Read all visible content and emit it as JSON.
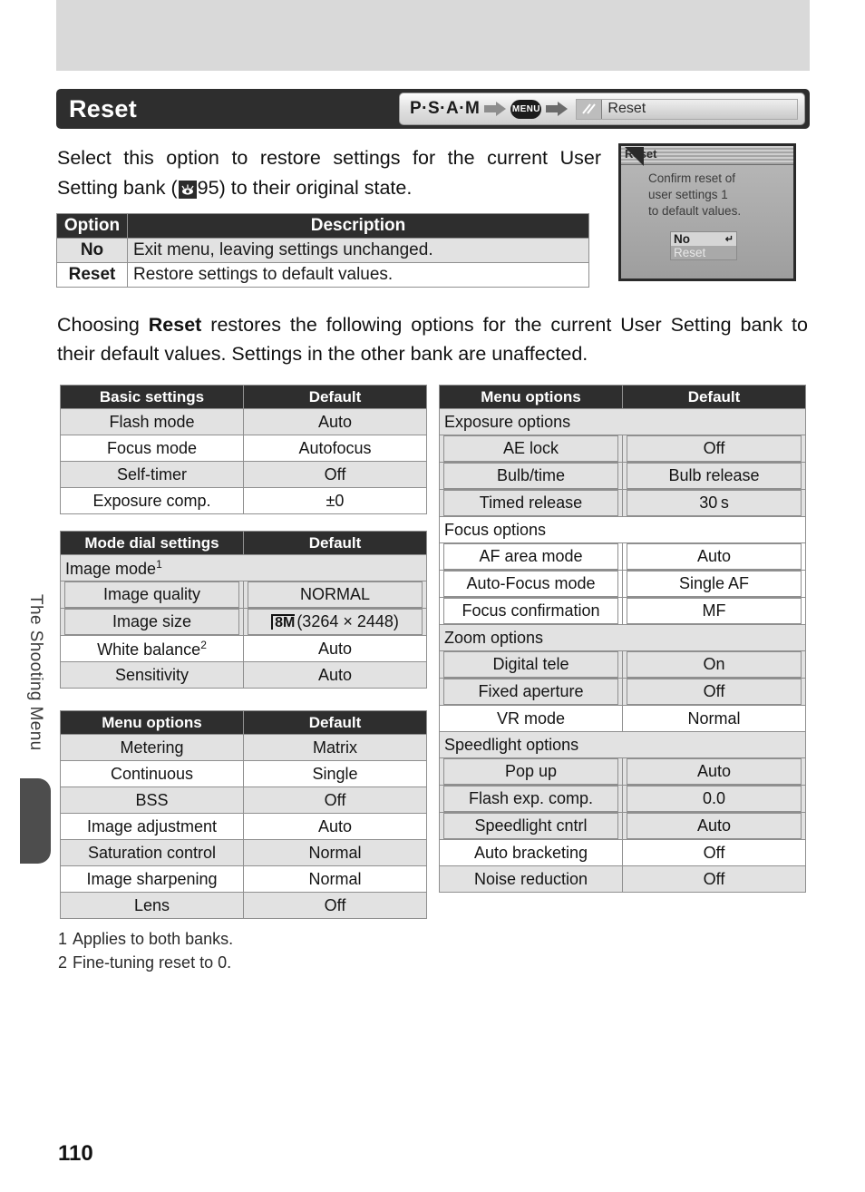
{
  "page": {
    "number": "110",
    "chapter_tab": "The Shooting Menu",
    "title": "Reset"
  },
  "breadcrumb": {
    "modes": "P·S·A·M",
    "menu_chip": "MENU",
    "field_label": "Reset",
    "field_icon": "camera-menu-icon",
    "arrow_icon": "right-arrow-icon"
  },
  "intro": {
    "line1": "Select this option to restore settings for the current",
    "line2_before": "User Setting bank (",
    "ref_icon": "eye-reference-icon",
    "ref_page": "95",
    "line2_after": ") to their original state."
  },
  "lcd": {
    "title": "Reset",
    "body_lines": [
      "Confirm reset of",
      "user settings 1",
      "to default values."
    ],
    "options": [
      {
        "label": "No",
        "selected": true,
        "glyph": "↵"
      },
      {
        "label": "Reset",
        "selected": false,
        "glyph": ""
      }
    ]
  },
  "option_table": {
    "headers": [
      "Option",
      "Description"
    ],
    "rows": [
      {
        "option": "No",
        "description": "Exit menu, leaving settings unchanged."
      },
      {
        "option": "Reset",
        "description": "Restore settings to default values."
      }
    ]
  },
  "mid_paragraph": {
    "before": "Choosing ",
    "bold": "Reset",
    "after": " restores the following options for the current User Setting bank to their default values.  Settings in the other bank are unaffected."
  },
  "tables": {
    "basic": {
      "headers": [
        "Basic settings",
        "Default"
      ],
      "rows": [
        {
          "name": "Flash mode",
          "value": "Auto"
        },
        {
          "name": "Focus mode",
          "value": "Autofocus"
        },
        {
          "name": "Self-timer",
          "value": "Off"
        },
        {
          "name": "Exposure comp.",
          "value": "±0"
        }
      ]
    },
    "mode_dial": {
      "headers": [
        "Mode dial settings",
        "Default"
      ],
      "group": {
        "label": "Image mode",
        "footnote": "1"
      },
      "group_rows": [
        {
          "name": "Image quality",
          "value": "NORMAL"
        },
        {
          "name": "Image size",
          "value": "(3264 × 2448)",
          "icon": "8M",
          "icon_name": "image-size-8m-icon"
        }
      ],
      "rows": [
        {
          "name": "White balance",
          "footnote": "2",
          "value": "Auto"
        },
        {
          "name": "Sensitivity",
          "value": "Auto"
        }
      ]
    },
    "menu_left": {
      "headers": [
        "Menu options",
        "Default"
      ],
      "rows": [
        {
          "name": "Metering",
          "value": "Matrix"
        },
        {
          "name": "Continuous",
          "value": "Single"
        },
        {
          "name": "BSS",
          "value": "Off"
        },
        {
          "name": "Image adjustment",
          "value": "Auto"
        },
        {
          "name": "Saturation control",
          "value": "Normal"
        },
        {
          "name": "Image sharpening",
          "value": "Normal"
        },
        {
          "name": "Lens",
          "value": "Off"
        }
      ]
    },
    "menu_right": {
      "headers": [
        "Menu options",
        "Default"
      ],
      "sections": [
        {
          "group": "Exposure options",
          "rows": [
            {
              "name": "AE lock",
              "value": "Off"
            },
            {
              "name": "Bulb/time",
              "value": "Bulb release"
            },
            {
              "name": "Timed release",
              "value": "30 s"
            }
          ]
        },
        {
          "group": "Focus options",
          "rows": [
            {
              "name": "AF area mode",
              "value": "Auto"
            },
            {
              "name": "Auto-Focus mode",
              "value": "Single AF"
            },
            {
              "name": "Focus confirmation",
              "value": "MF"
            }
          ]
        },
        {
          "group": "Zoom options",
          "rows": [
            {
              "name": "Digital tele",
              "value": "On"
            },
            {
              "name": "Fixed aperture",
              "value": "Off"
            }
          ]
        },
        {
          "group": null,
          "rows": [
            {
              "name": "VR mode",
              "value": "Normal"
            }
          ]
        },
        {
          "group": "Speedlight options",
          "rows": [
            {
              "name": "Pop up",
              "value": "Auto"
            },
            {
              "name": "Flash exp. comp.",
              "value": "0.0"
            },
            {
              "name": "Speedlight cntrl",
              "value": "Auto"
            }
          ]
        },
        {
          "group": null,
          "rows": [
            {
              "name": "Auto bracketing",
              "value": "Off"
            },
            {
              "name": "Noise reduction",
              "value": "Off"
            }
          ]
        }
      ]
    }
  },
  "footnotes": [
    {
      "num": "1",
      "text": "Applies to both banks."
    },
    {
      "num": "2",
      "text": "Fine-tuning reset to 0."
    }
  ],
  "colors": {
    "header_bar": "#2e2e2e",
    "row_shade": "#e2e2e2",
    "rule": "#8f8f8f",
    "top_band": "#d9d9d9"
  }
}
